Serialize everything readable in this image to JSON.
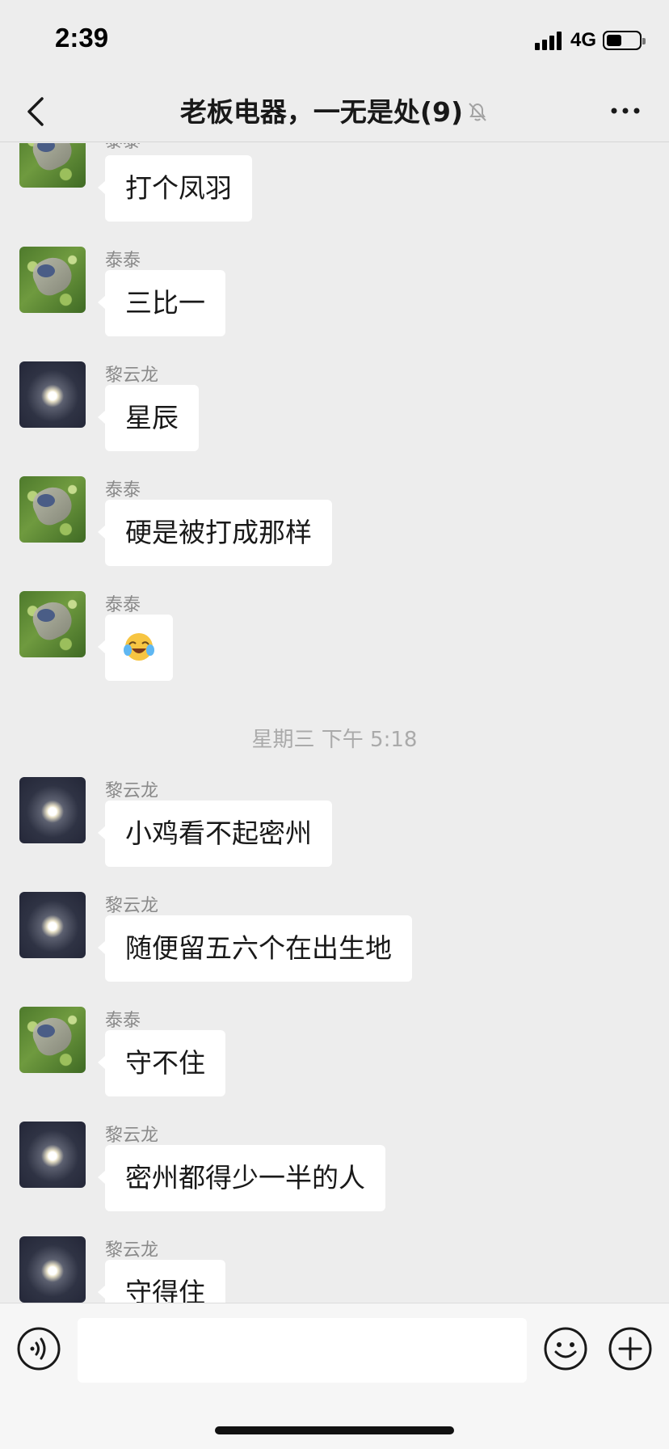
{
  "status_bar": {
    "time": "2:39",
    "network": "4G"
  },
  "nav": {
    "title": "老板电器，一无是处(9)"
  },
  "messages": [
    {
      "sender": "泰泰",
      "text": "打个凤羽",
      "avatar": "grass"
    },
    {
      "sender": "泰泰",
      "text": "三比一",
      "avatar": "grass"
    },
    {
      "sender": "黎云龙",
      "text": "星辰",
      "avatar": "moon"
    },
    {
      "sender": "泰泰",
      "text": "硬是被打成那样",
      "avatar": "grass"
    },
    {
      "sender": "泰泰",
      "text": "",
      "avatar": "grass",
      "emoji": "crying-laughing-emoji"
    },
    {
      "sender": "黎云龙",
      "text": "小鸡看不起密州",
      "avatar": "moon"
    },
    {
      "sender": "黎云龙",
      "text": "随便留五六个在出生地",
      "avatar": "moon"
    },
    {
      "sender": "泰泰",
      "text": "守不住",
      "avatar": "grass"
    },
    {
      "sender": "黎云龙",
      "text": "密州都得少一半的人",
      "avatar": "moon"
    },
    {
      "sender": "黎云龙",
      "text": "守得住",
      "avatar": "moon"
    }
  ],
  "timestamp": "星期三 下午 5:18",
  "colors": {
    "background": "#ededed",
    "bubble": "#ffffff",
    "sender": "#8a8a8a"
  }
}
